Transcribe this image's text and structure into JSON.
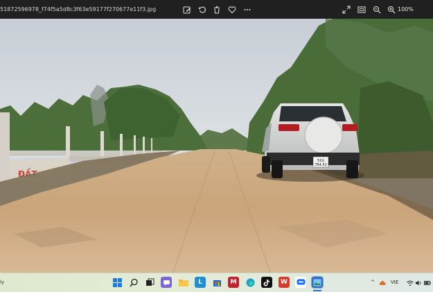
{
  "viewer": {
    "filename": "51872596978_f74f5a5d8c3f63e59177f270677e11f3.jpg",
    "zoom": "100%",
    "toolbar_left_icons": [
      "edit-image-icon",
      "rotate-icon",
      "delete-icon",
      "favorite-icon",
      "more-icon"
    ],
    "toolbar_right_icons": [
      "fullscreen-icon",
      "fit-window-icon",
      "zoom-out-icon",
      "zoom-in-icon"
    ]
  },
  "photo": {
    "license_plate_line1": "51G",
    "license_plate_line2": "784.52",
    "wall_graffiti": "ĐẤT"
  },
  "taskbar": {
    "status_text": "ly",
    "apps": [
      "start",
      "search",
      "task-view",
      "chat",
      "file-explorer",
      "app-l",
      "store",
      "mcafee",
      "tiktok",
      "office",
      "zalo",
      "photos"
    ],
    "tray": {
      "language": "VIE",
      "chevron": "^"
    }
  },
  "colors": {
    "viewer_bg": "#202020",
    "taskbar_bg": "#e0eacf",
    "sky": "#cfd6dc",
    "road": "#c9a678"
  }
}
